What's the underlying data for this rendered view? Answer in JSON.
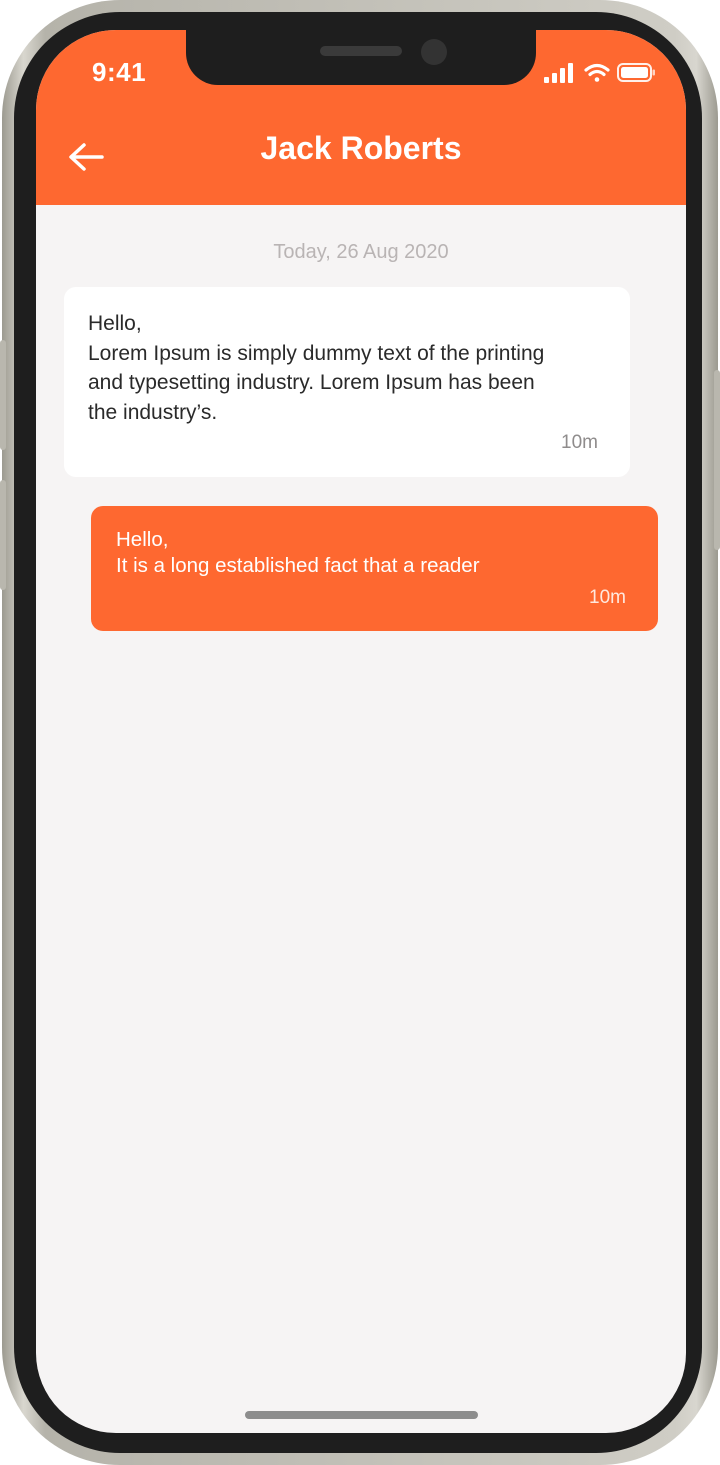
{
  "status_bar": {
    "time": "9:41"
  },
  "header": {
    "title": "Jack Roberts"
  },
  "chat": {
    "date_separator": "Today, 26 Aug 2020",
    "messages": [
      {
        "direction": "incoming",
        "text": "Hello,\nLorem Ipsum is simply dummy text of the printing\nand typesetting industry. Lorem Ipsum has been\nthe industry’s.",
        "time": "10m"
      },
      {
        "direction": "outgoing",
        "text": "Hello,\nIt is a long established fact that a reader",
        "time": "10m"
      }
    ]
  },
  "theme": {
    "accent": "#fe6830",
    "background": "#f6f4f4",
    "incoming_bubble": "#ffffff"
  },
  "icons": {
    "back": "arrow-left-icon",
    "signal": "cellular-signal-icon",
    "wifi": "wifi-icon",
    "battery": "battery-icon"
  }
}
